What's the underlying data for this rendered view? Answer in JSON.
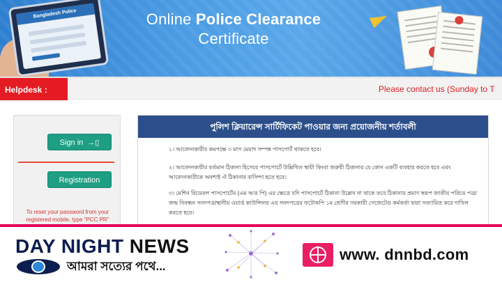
{
  "banner": {
    "title_line1_a": "Online",
    "title_line1_b": "Police Clearance",
    "title_line2": "Certificate",
    "tablet_label": "Bangladesh Police"
  },
  "helpbar": {
    "helpdesk_label": "Helpdesk :",
    "marquee_text": "Please contact us (Sunday to T"
  },
  "login": {
    "signin_label": "Sign in",
    "registration_label": "Registration",
    "reset_text": "To reset your password from your registered mobile, type \"PCC PR\""
  },
  "conditions": {
    "heading": "পুলিশ ক্লিয়ারেন্স সার্টিফিকেট পাওয়ার জন্য প্রয়োজনীয় শর্তাবলী",
    "items": [
      "১। আবেদনকারীর কমপক্ষে ৩ মাস মেয়াদ সম্পন্ন পাসপোর্ট থাকতে হবে।",
      "২। আবেদনকারীর বর্তমান ঠিকানা হিসেবে পাসপোর্টে উল্লিখিত স্থায়ী কিংবা জরুরী ঠিকানার যে কোন একটি ব্যবহার করতে হবে এবং আবেদনকারীকে অবশ্যই ঐ ঠিকানার বাসিন্দা হতে হবে।",
      "৩। মেশিন রিডেবল পাসপোর্টের (এম আর পি) এর ক্ষেত্রে যদি পাসপোর্টে ঠিকানা উল্লেখ না থাকে তবে ঠিকানার প্রমাণ স্বরূপ জাতীয় পরিচয় পত্র/জন্ম নিবন্ধন সনদপত্র/স্থানীয় ওয়ার্ড কাউন্সিলর এর সনদপত্রের ফটোকপি ১ম শ্রেণীর সরকারী গেজেটেড কর্মকর্তা দ্বারা সত্যায়িত করে দাখিল করতে হবে।"
    ]
  },
  "news_strip": {
    "brand_a": "DAY NIGHT",
    "brand_b": "NEWS",
    "tagline": "আমরা সত্যের পথে...",
    "url": "www. dnnbd.com"
  },
  "icons": {
    "signin": "sign-in-icon",
    "globe": "globe-icon",
    "eye": "eye-logo-icon"
  },
  "colors": {
    "header_blue": "#2c4f8c",
    "button_green": "#1e9e83",
    "helpdesk_red": "#e51b23",
    "strip_pink": "#e5005a"
  }
}
